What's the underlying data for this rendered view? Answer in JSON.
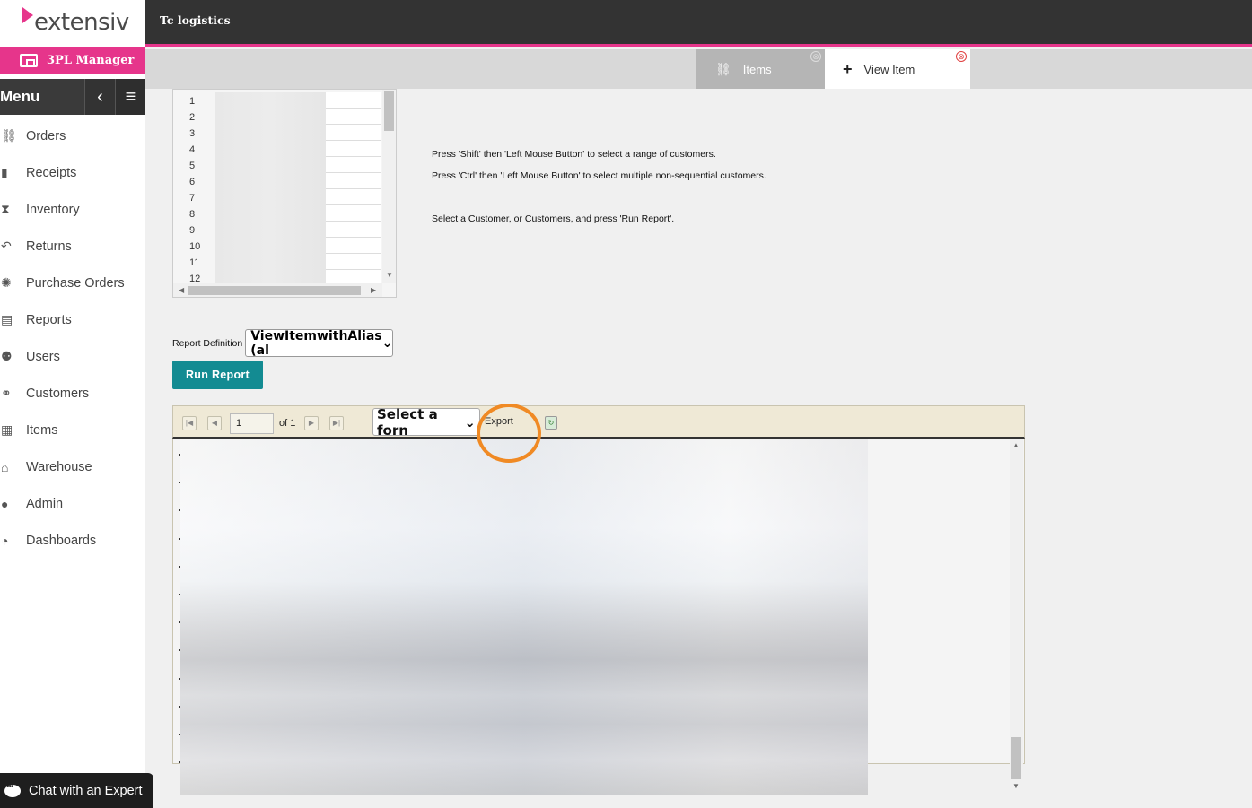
{
  "brand": {
    "logo_text": "extensiv",
    "product": "3PL Manager"
  },
  "header": {
    "company": "Tc logistics"
  },
  "menu": {
    "title": "Menu",
    "collapse_icon": "chevron-left-icon",
    "toggle_icon": "hamburger-icon",
    "items": [
      {
        "label": "Orders",
        "icon": "sitemap-icon"
      },
      {
        "label": "Receipts",
        "icon": "file-icon"
      },
      {
        "label": "Inventory",
        "icon": "hourglass-icon"
      },
      {
        "label": "Returns",
        "icon": "undo-icon"
      },
      {
        "label": "Purchase Orders",
        "icon": "cog-icon"
      },
      {
        "label": "Reports",
        "icon": "id-card-icon"
      },
      {
        "label": "Users",
        "icon": "users-icon"
      },
      {
        "label": "Customers",
        "icon": "handshake-icon"
      },
      {
        "label": "Items",
        "icon": "grid-icon"
      },
      {
        "label": "Warehouse",
        "icon": "home-icon"
      },
      {
        "label": "Admin",
        "icon": "user-icon"
      },
      {
        "label": "Dashboards",
        "icon": "gauge-icon"
      }
    ]
  },
  "tabs": [
    {
      "label": "Items",
      "icon": "sitemap-icon",
      "close": "⊗"
    },
    {
      "label": "View Item",
      "icon": "plus-icon",
      "close": "⊗"
    }
  ],
  "customer_list": {
    "rows": [
      "1",
      "2",
      "3",
      "4",
      "5",
      "6",
      "7",
      "8",
      "9",
      "10",
      "11",
      "12"
    ]
  },
  "instructions": {
    "line1": "Press 'Shift' then 'Left Mouse Button' to select a range of customers.",
    "line2": "Press 'Ctrl' then 'Left Mouse Button' to select multiple non-sequential customers.",
    "line3": "Select a Customer, or Customers, and press 'Run Report'."
  },
  "report": {
    "definition_label": "Report Definition",
    "definition_value": "ViewItemwithAlias (al",
    "run_label": "Run Report"
  },
  "viewer": {
    "page_current": "1",
    "page_of": "of 1",
    "format_value": "Select a forn",
    "export_label": "Export"
  },
  "chat": {
    "label": "Chat with an Expert"
  },
  "colors": {
    "brand_pink": "#e6358b",
    "teal_button": "#138b92",
    "highlight_orange": "#f08a24"
  }
}
